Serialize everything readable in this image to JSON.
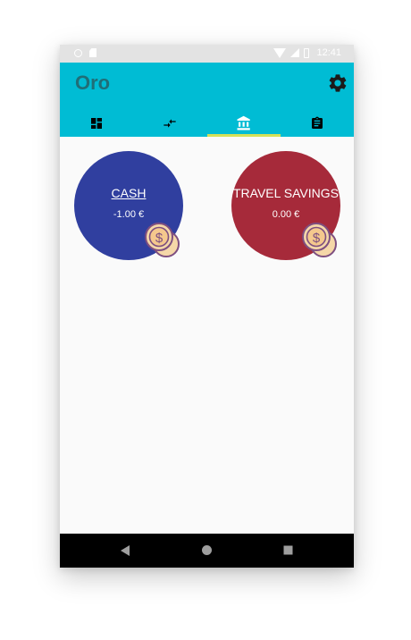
{
  "status_bar": {
    "time": "12:41",
    "icons": [
      "circle-icon",
      "sd-card-icon",
      "wifi-icon",
      "signal-icon",
      "battery-icon"
    ]
  },
  "app": {
    "title": "Oro",
    "header_color": "#00bcd4",
    "tab_indicator_color": "#d4e157"
  },
  "tabs": [
    {
      "icon": "dashboard-icon",
      "selected": false
    },
    {
      "icon": "transfer-icon",
      "selected": false
    },
    {
      "icon": "bank-icon",
      "selected": true
    },
    {
      "icon": "clipboard-icon",
      "selected": false
    }
  ],
  "accounts": [
    {
      "name": "CASH",
      "balance": "-1.00 €",
      "color": "#303f9f",
      "icon": "coins-icon"
    },
    {
      "name": "TRAVEL SAVINGS",
      "balance": "0.00 €",
      "color": "#a62a3a",
      "icon": "coins-icon"
    }
  ],
  "fab": {
    "label": "+",
    "color": "#ede27a"
  },
  "nav_bar": {
    "icons": [
      "back-icon",
      "home-icon",
      "recents-icon"
    ]
  }
}
